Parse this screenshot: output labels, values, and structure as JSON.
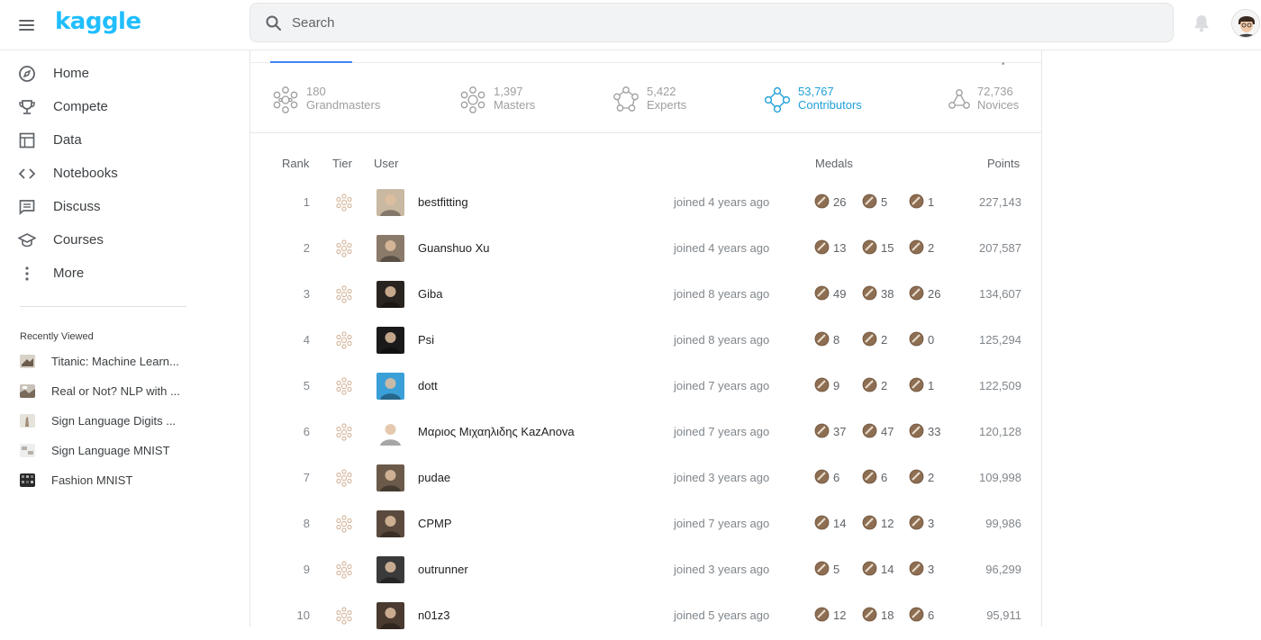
{
  "app": {
    "logo": "kaggle"
  },
  "search": {
    "placeholder": "Search"
  },
  "sidebar": {
    "items": [
      {
        "label": "Home",
        "icon": "compass-icon"
      },
      {
        "label": "Compete",
        "icon": "trophy-icon"
      },
      {
        "label": "Data",
        "icon": "table-icon"
      },
      {
        "label": "Notebooks",
        "icon": "code-icon"
      },
      {
        "label": "Discuss",
        "icon": "comment-icon"
      },
      {
        "label": "Courses",
        "icon": "graduation-cap-icon"
      },
      {
        "label": "More",
        "icon": "more-vertical-icon"
      }
    ],
    "recent_title": "Recently Viewed",
    "recent": [
      {
        "label": "Titanic: Machine Learn..."
      },
      {
        "label": "Real or Not? NLP with ..."
      },
      {
        "label": "Sign Language Digits ..."
      },
      {
        "label": "Sign Language MNIST"
      },
      {
        "label": "Fashion MNIST"
      }
    ]
  },
  "tiers": [
    {
      "count": "180",
      "name": "Grandmasters",
      "color": "#9e9e9e"
    },
    {
      "count": "1,397",
      "name": "Masters",
      "color": "#9e9e9e"
    },
    {
      "count": "5,422",
      "name": "Experts",
      "color": "#9e9e9e"
    },
    {
      "count": "53,767",
      "name": "Contributors",
      "color": "#20a0d8"
    },
    {
      "count": "72,736",
      "name": "Novices",
      "color": "#9e9e9e"
    }
  ],
  "table": {
    "headers": {
      "rank": "Rank",
      "tier": "Tier",
      "user": "User",
      "medals": "Medals",
      "points": "Points"
    },
    "rows": [
      {
        "rank": "1",
        "user": "bestfitting",
        "joined": "joined 4 years ago",
        "gold": "26",
        "silver": "5",
        "bronze": "1",
        "points": "227,143"
      },
      {
        "rank": "2",
        "user": "Guanshuo Xu",
        "joined": "joined 4 years ago",
        "gold": "13",
        "silver": "15",
        "bronze": "2",
        "points": "207,587"
      },
      {
        "rank": "3",
        "user": "Giba",
        "joined": "joined 8 years ago",
        "gold": "49",
        "silver": "38",
        "bronze": "26",
        "points": "134,607"
      },
      {
        "rank": "4",
        "user": "Psi",
        "joined": "joined 8 years ago",
        "gold": "8",
        "silver": "2",
        "bronze": "0",
        "points": "125,294"
      },
      {
        "rank": "5",
        "user": "dott",
        "joined": "joined 7 years ago",
        "gold": "9",
        "silver": "2",
        "bronze": "1",
        "points": "122,509"
      },
      {
        "rank": "6",
        "user": "Μαριος Μιχαηλιδης KazAnova",
        "joined": "joined 7 years ago",
        "gold": "37",
        "silver": "47",
        "bronze": "33",
        "points": "120,128"
      },
      {
        "rank": "7",
        "user": "pudae",
        "joined": "joined 3 years ago",
        "gold": "6",
        "silver": "6",
        "bronze": "2",
        "points": "109,998"
      },
      {
        "rank": "8",
        "user": "CPMP",
        "joined": "joined 7 years ago",
        "gold": "14",
        "silver": "12",
        "bronze": "3",
        "points": "99,986"
      },
      {
        "rank": "9",
        "user": "outrunner",
        "joined": "joined 3 years ago",
        "gold": "5",
        "silver": "14",
        "bronze": "3",
        "points": "96,299"
      },
      {
        "rank": "10",
        "user": "n01z3",
        "joined": "joined 5 years ago",
        "gold": "12",
        "silver": "18",
        "bronze": "6",
        "points": "95,911"
      }
    ]
  },
  "colors": {
    "brand": "#20beff",
    "accent": "#20a0d8",
    "tier_icon": "#d4b59a",
    "medal": "#8d6e52"
  }
}
